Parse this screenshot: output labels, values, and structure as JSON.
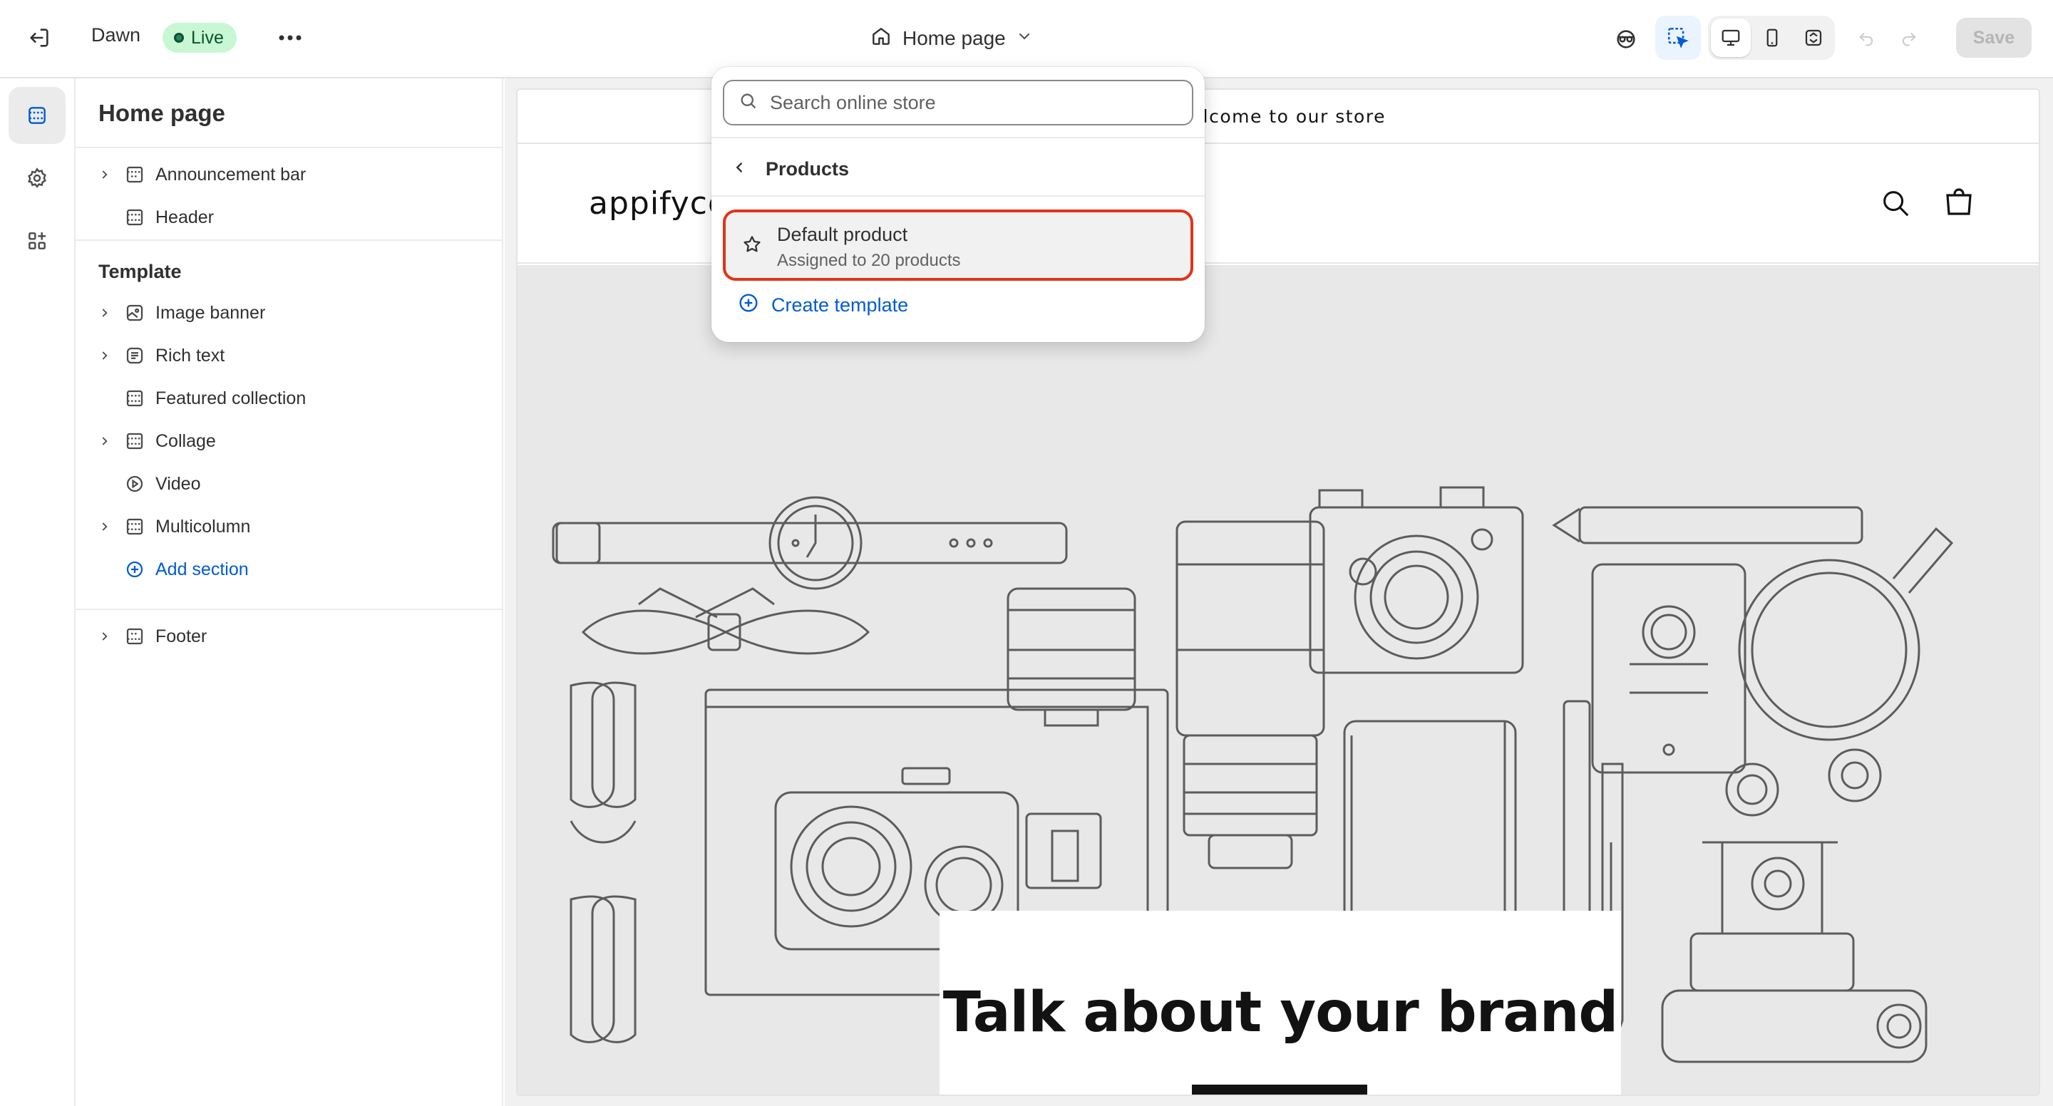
{
  "topbar": {
    "exit_icon": "exit-icon",
    "theme_name": "Dawn",
    "status_badge": "Live",
    "more_icon": "more-horizontal-icon",
    "page_selector": "Home page",
    "save_label": "Save",
    "colors": {
      "badge_bg": "#c8f7d4",
      "badge_text": "#0c5132"
    }
  },
  "rail": {
    "items": [
      {
        "icon": "sections-icon",
        "active": true
      },
      {
        "icon": "settings-gear-icon",
        "active": false
      },
      {
        "icon": "apps-icon",
        "active": false
      }
    ]
  },
  "sidebar": {
    "title": "Home page",
    "header_group": [
      {
        "label": "Announcement bar",
        "expandable": true
      },
      {
        "label": "Header",
        "expandable": false
      }
    ],
    "template_label": "Template",
    "template_items": [
      {
        "label": "Image banner",
        "expandable": true
      },
      {
        "label": "Rich text",
        "expandable": true
      },
      {
        "label": "Featured collection",
        "expandable": false
      },
      {
        "label": "Collage",
        "expandable": true
      },
      {
        "label": "Video",
        "expandable": false
      },
      {
        "label": "Multicolumn",
        "expandable": true
      }
    ],
    "add_section": "Add section",
    "footer_items": [
      {
        "label": "Footer",
        "expandable": true
      }
    ]
  },
  "preview": {
    "announcement": "Welcome to our store",
    "logo_text": "appifycommerce",
    "banner_heading": "Talk about your brand"
  },
  "dropdown": {
    "search_placeholder": "Search online store",
    "back_label": "Products",
    "option": {
      "name": "Default product",
      "description": "Assigned to 20 products"
    },
    "create_label": "Create template",
    "colors": {
      "highlight_border": "#e0341a",
      "link": "#005bd3"
    }
  }
}
